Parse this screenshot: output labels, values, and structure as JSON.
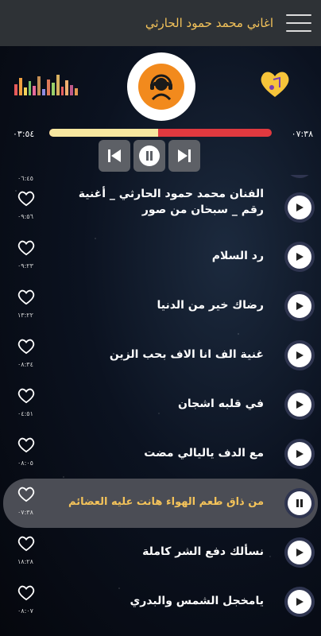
{
  "header": {
    "title": "اغاني محمد حمود الحارثي"
  },
  "player": {
    "elapsed": "٠٣:٥٤",
    "total": "٠٧:٣٨",
    "progress": 0.49
  },
  "songs": [
    {
      "title": "",
      "duration": "٠٦:٤٥"
    },
    {
      "title": "الفنان محمد حمود الحارثي _ أغنية رقم _ سبحان من صور",
      "duration": "٠٩:٥٦"
    },
    {
      "title": "رد السلام",
      "duration": "٠٩:٢٣"
    },
    {
      "title": "رضاك خير من الدنيا",
      "duration": "١٣:٢٢"
    },
    {
      "title": "غنية الف انا الاف بحب الزين",
      "duration": "٠٨:٣٤"
    },
    {
      "title": "في قلبه اشجان",
      "duration": "٠٤:٥١"
    },
    {
      "title": "مع الدف ياليالي مضت",
      "duration": "٠٨:٠٥"
    },
    {
      "title": "من ذاق طعم الهواء هانت عليه العضائم",
      "duration": "٠٧:٣٨"
    },
    {
      "title": "نسألك دفع الشر كاملة",
      "duration": "١٨:٢٨"
    },
    {
      "title": "يامخجل الشمس والبدري",
      "duration": "٠٨:٠٧"
    }
  ],
  "colors": {
    "accent": "#f4c35a",
    "seek_remaining": "#e0393f",
    "seek_played": "#f7e7a0",
    "logo": "#f28a1d",
    "topbar": "#2e3236"
  }
}
